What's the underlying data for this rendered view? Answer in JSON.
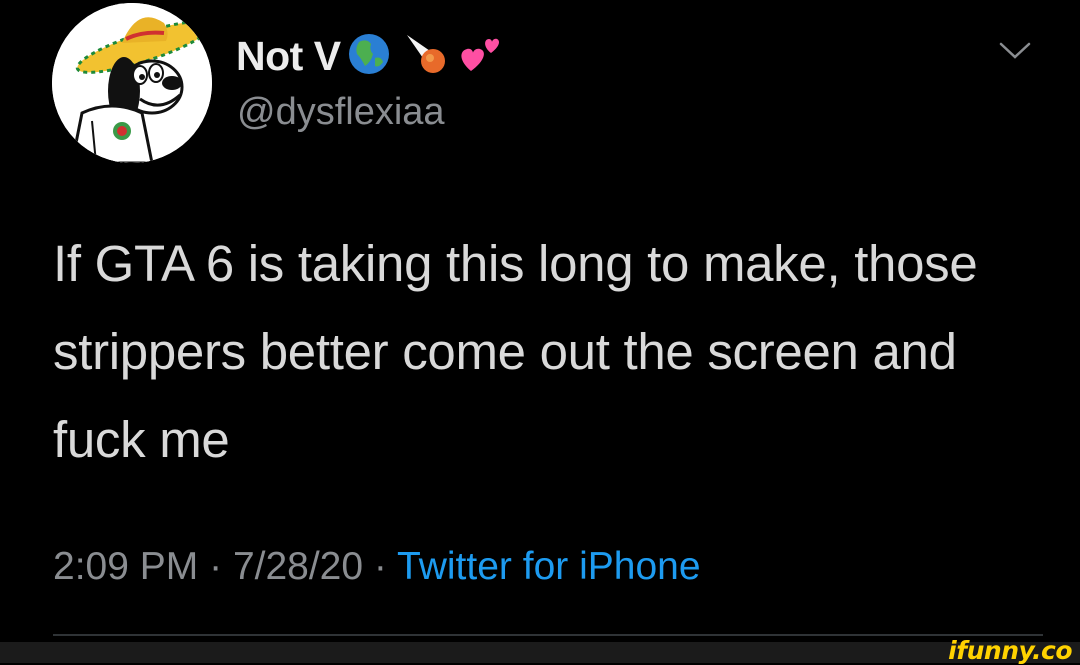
{
  "tweet": {
    "display_name": "Not V",
    "name_emojis": [
      "globe-americas-emoji",
      "meteor-emoji",
      "two-hearts-emoji"
    ],
    "handle": "@dysflexiaa",
    "text": "If GTA 6 is taking this long to make, those strippers better come out the screen and fuck me",
    "time": "2:09 PM",
    "date": "7/28/20",
    "separator": "·",
    "source": "Twitter for iPhone"
  },
  "icons": {
    "menu": "chevron-down-icon",
    "avatar": "goofy-sombrero-avatar"
  },
  "watermark": {
    "text": "ifunny.co"
  },
  "colors": {
    "background": "#000000",
    "text": "#d9d9d9",
    "secondary": "#8a8d91",
    "link": "#1d9bf0",
    "watermark": "#ffd200"
  }
}
